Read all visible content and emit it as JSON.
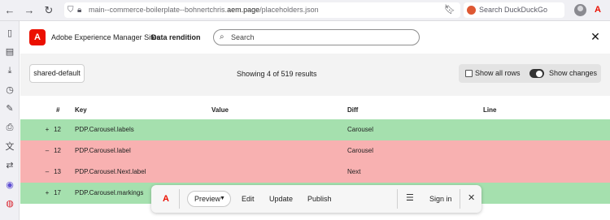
{
  "browser": {
    "url_prefix": "main--commerce-boilerplate--bohnertchris.",
    "url_domain": "aem.page",
    "url_path": "/placeholders.json",
    "search_placeholder": "Search DuckDuckGo"
  },
  "app": {
    "title": "Adobe Experience Manager Sites",
    "subtitle": "Data rendition",
    "search_placeholder": "Search"
  },
  "controls": {
    "sheet_button": "shared-default",
    "result_count": "Showing 4 of 519 results",
    "show_all_rows": "Show all rows",
    "show_all_rows_checked": false,
    "show_changes": "Show changes",
    "show_changes_on": true
  },
  "table": {
    "columns": {
      "num": "#",
      "key": "Key",
      "value": "Value",
      "diff": "Diff",
      "line": "Line"
    },
    "rows": [
      {
        "sign": "+",
        "line": "12",
        "key": "PDP.Carousel.labels",
        "value": "",
        "diff": "Carousel",
        "status": "added"
      },
      {
        "sign": "–",
        "line": "12",
        "key": "PDP.Carousel.label",
        "value": "",
        "diff": "Carousel",
        "status": "removed"
      },
      {
        "sign": "–",
        "line": "13",
        "key": "PDP.Carousel.Next.label",
        "value": "",
        "diff": "Next",
        "status": "removed"
      },
      {
        "sign": "+",
        "line": "17",
        "key": "PDP.Carousel.markings",
        "value": "",
        "diff": "",
        "status": "added"
      }
    ]
  },
  "sidekick": {
    "preview": "Preview",
    "edit": "Edit",
    "update": "Update",
    "publish": "Publish",
    "sign_in": "Sign in"
  },
  "colors": {
    "added_row": "#a5e0ae",
    "removed_row": "#f8b1b1",
    "adobe_red": "#eb1000"
  }
}
